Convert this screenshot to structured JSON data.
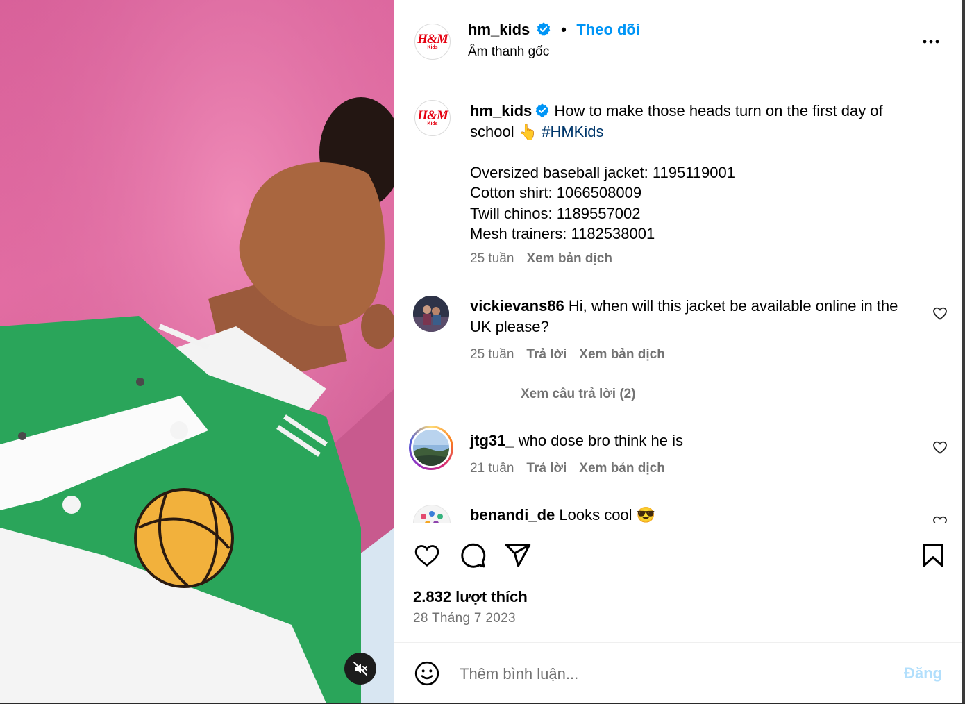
{
  "post": {
    "username": "hm_kids",
    "follow_label": "Theo dõi",
    "separator": "•",
    "audio_label": "Âm thanh gốc",
    "avatar_logo": "H&M",
    "avatar_sub": "Kids"
  },
  "caption": {
    "username": "hm_kids",
    "text": "How to make those heads turn on the first day of school 👆",
    "hashtag": "#HMKids",
    "lines": [
      "Oversized baseball jacket: 1195119001",
      "Cotton shirt: 1066508009",
      "Twill chinos: 1189557002",
      "Mesh trainers: 1182538001"
    ],
    "time": "25 tuần",
    "translate_label": "Xem bản dịch"
  },
  "comments": [
    {
      "username": "vickievans86",
      "text": "Hi, when will this jacket be available online in the UK please?",
      "time": "25 tuần",
      "reply_label": "Trả lời",
      "translate_label": "Xem bản dịch",
      "view_replies_label": "Xem câu trả lời (2)"
    },
    {
      "username": "jtg31_",
      "text": "who dose bro think he is",
      "time": "21 tuần",
      "reply_label": "Trả lời",
      "translate_label": "Xem bản dịch"
    },
    {
      "username": "benandi_de",
      "text": "Looks cool 😎"
    }
  ],
  "stats": {
    "likes": "2.832 lượt thích",
    "date": "28 Tháng 7 2023"
  },
  "composer": {
    "placeholder": "Thêm bình luận...",
    "post_label": "Đăng"
  },
  "colors": {
    "link_blue": "#0095f6",
    "hashtag": "#00376b",
    "secondary_text": "#737373",
    "post_disabled": "#b2dffc",
    "verified_badge": "#0095f6",
    "brand_red": "#e50010"
  },
  "icons": [
    "verified-badge-icon",
    "more-options-icon",
    "heart-icon",
    "comment-icon",
    "share-icon",
    "bookmark-icon",
    "emoji-icon",
    "mute-icon"
  ]
}
